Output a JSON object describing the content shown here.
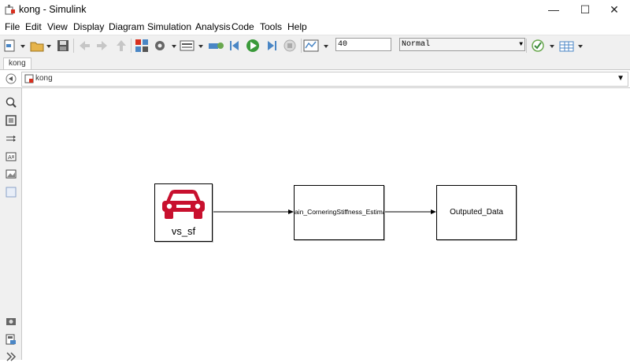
{
  "window": {
    "title": "kong - Simulink"
  },
  "window_controls": {
    "minimize": "—",
    "maximize": "☐",
    "close": "✕"
  },
  "menu": [
    "File",
    "Edit",
    "View",
    "Display",
    "Diagram",
    "Simulation",
    "Analysis",
    "Code",
    "Tools",
    "Help"
  ],
  "toolbar": {
    "stop_time": "40",
    "sim_mode": "Normal"
  },
  "tab": {
    "label": "kong"
  },
  "address": {
    "breadcrumb": "kong",
    "dropdown_glyph": "▼"
  },
  "palette_icons": [
    "zoom-icon",
    "fit-to-view-icon",
    "arrow-icon",
    "annotation-icon",
    "image-icon",
    "area-icon",
    "model-browser-icon",
    "report-icon",
    "expand-icon"
  ],
  "diagram": {
    "source_block": {
      "label": "vs_sf",
      "icon": "car-icon",
      "icon_color": "#c8102e"
    },
    "middle_block": {
      "label": "ain_CorneringStiffness_Estimati"
    },
    "sink_block": {
      "label": "Outputed_Data"
    }
  }
}
